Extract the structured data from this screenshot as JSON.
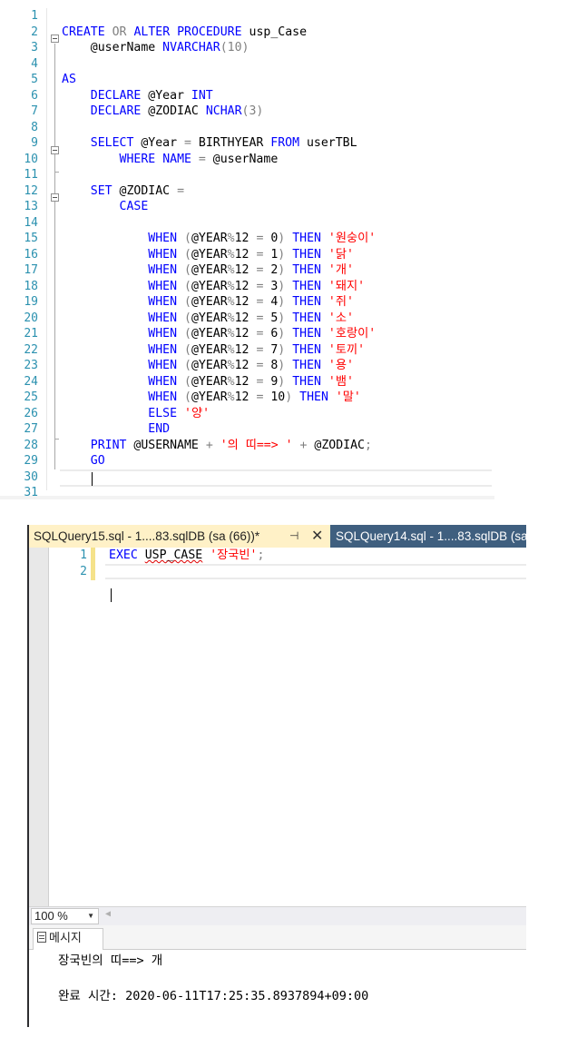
{
  "top_editor": {
    "line_numbers": [
      "1",
      "2",
      "3",
      "4",
      "5",
      "6",
      "7",
      "8",
      "9",
      "10",
      "11",
      "12",
      "13",
      "14",
      "15",
      "16",
      "17",
      "18",
      "19",
      "20",
      "21",
      "22",
      "23",
      "24",
      "25",
      "26",
      "27",
      "28",
      "29",
      "30",
      "31"
    ],
    "lines": [
      [],
      [
        {
          "t": "CREATE",
          "c": "kw"
        },
        {
          "t": " ",
          "c": ""
        },
        {
          "t": "OR",
          "c": "gray"
        },
        {
          "t": " ",
          "c": ""
        },
        {
          "t": "ALTER",
          "c": "kw"
        },
        {
          "t": " ",
          "c": ""
        },
        {
          "t": "PROCEDURE",
          "c": "kw"
        },
        {
          "t": " usp_Case",
          "c": ""
        }
      ],
      [
        {
          "t": "    @userName ",
          "c": ""
        },
        {
          "t": "NVARCHAR",
          "c": "kw"
        },
        {
          "t": "(10)",
          "c": "gray"
        }
      ],
      [],
      [
        {
          "t": "AS",
          "c": "kw"
        }
      ],
      [
        {
          "t": "    ",
          "c": ""
        },
        {
          "t": "DECLARE",
          "c": "kw"
        },
        {
          "t": " @Year ",
          "c": ""
        },
        {
          "t": "INT",
          "c": "kw"
        }
      ],
      [
        {
          "t": "    ",
          "c": ""
        },
        {
          "t": "DECLARE",
          "c": "kw"
        },
        {
          "t": " @ZODIAC ",
          "c": ""
        },
        {
          "t": "NCHAR",
          "c": "kw"
        },
        {
          "t": "(3)",
          "c": "gray"
        }
      ],
      [],
      [
        {
          "t": "    ",
          "c": ""
        },
        {
          "t": "SELECT",
          "c": "kw"
        },
        {
          "t": " @Year ",
          "c": ""
        },
        {
          "t": "=",
          "c": "gray"
        },
        {
          "t": " BIRTHYEAR ",
          "c": ""
        },
        {
          "t": "FROM",
          "c": "kw"
        },
        {
          "t": " userTBL",
          "c": ""
        }
      ],
      [
        {
          "t": "        ",
          "c": ""
        },
        {
          "t": "WHERE",
          "c": "kw"
        },
        {
          "t": " ",
          "c": ""
        },
        {
          "t": "NAME",
          "c": "kw"
        },
        {
          "t": " ",
          "c": ""
        },
        {
          "t": "=",
          "c": "gray"
        },
        {
          "t": " @userName",
          "c": ""
        }
      ],
      [],
      [
        {
          "t": "    ",
          "c": ""
        },
        {
          "t": "SET",
          "c": "kw"
        },
        {
          "t": " @ZODIAC ",
          "c": ""
        },
        {
          "t": "=",
          "c": "gray"
        }
      ],
      [
        {
          "t": "        ",
          "c": ""
        },
        {
          "t": "CASE",
          "c": "kw"
        }
      ],
      [],
      [
        {
          "t": "            ",
          "c": ""
        },
        {
          "t": "WHEN",
          "c": "kw"
        },
        {
          "t": " ",
          "c": ""
        },
        {
          "t": "(",
          "c": "gray"
        },
        {
          "t": "@YEAR",
          "c": ""
        },
        {
          "t": "%",
          "c": "gray"
        },
        {
          "t": "12 ",
          "c": ""
        },
        {
          "t": "=",
          "c": "gray"
        },
        {
          "t": " 0",
          "c": ""
        },
        {
          "t": ")",
          "c": "gray"
        },
        {
          "t": " ",
          "c": ""
        },
        {
          "t": "THEN",
          "c": "kw"
        },
        {
          "t": " ",
          "c": ""
        },
        {
          "t": "'원숭이'",
          "c": "str"
        }
      ],
      [
        {
          "t": "            ",
          "c": ""
        },
        {
          "t": "WHEN",
          "c": "kw"
        },
        {
          "t": " ",
          "c": ""
        },
        {
          "t": "(",
          "c": "gray"
        },
        {
          "t": "@YEAR",
          "c": ""
        },
        {
          "t": "%",
          "c": "gray"
        },
        {
          "t": "12 ",
          "c": ""
        },
        {
          "t": "=",
          "c": "gray"
        },
        {
          "t": " 1",
          "c": ""
        },
        {
          "t": ")",
          "c": "gray"
        },
        {
          "t": " ",
          "c": ""
        },
        {
          "t": "THEN",
          "c": "kw"
        },
        {
          "t": " ",
          "c": ""
        },
        {
          "t": "'닭'",
          "c": "str"
        }
      ],
      [
        {
          "t": "            ",
          "c": ""
        },
        {
          "t": "WHEN",
          "c": "kw"
        },
        {
          "t": " ",
          "c": ""
        },
        {
          "t": "(",
          "c": "gray"
        },
        {
          "t": "@YEAR",
          "c": ""
        },
        {
          "t": "%",
          "c": "gray"
        },
        {
          "t": "12 ",
          "c": ""
        },
        {
          "t": "=",
          "c": "gray"
        },
        {
          "t": " 2",
          "c": ""
        },
        {
          "t": ")",
          "c": "gray"
        },
        {
          "t": " ",
          "c": ""
        },
        {
          "t": "THEN",
          "c": "kw"
        },
        {
          "t": " ",
          "c": ""
        },
        {
          "t": "'개'",
          "c": "str"
        }
      ],
      [
        {
          "t": "            ",
          "c": ""
        },
        {
          "t": "WHEN",
          "c": "kw"
        },
        {
          "t": " ",
          "c": ""
        },
        {
          "t": "(",
          "c": "gray"
        },
        {
          "t": "@YEAR",
          "c": ""
        },
        {
          "t": "%",
          "c": "gray"
        },
        {
          "t": "12 ",
          "c": ""
        },
        {
          "t": "=",
          "c": "gray"
        },
        {
          "t": " 3",
          "c": ""
        },
        {
          "t": ")",
          "c": "gray"
        },
        {
          "t": " ",
          "c": ""
        },
        {
          "t": "THEN",
          "c": "kw"
        },
        {
          "t": " ",
          "c": ""
        },
        {
          "t": "'돼지'",
          "c": "str"
        }
      ],
      [
        {
          "t": "            ",
          "c": ""
        },
        {
          "t": "WHEN",
          "c": "kw"
        },
        {
          "t": " ",
          "c": ""
        },
        {
          "t": "(",
          "c": "gray"
        },
        {
          "t": "@YEAR",
          "c": ""
        },
        {
          "t": "%",
          "c": "gray"
        },
        {
          "t": "12 ",
          "c": ""
        },
        {
          "t": "=",
          "c": "gray"
        },
        {
          "t": " 4",
          "c": ""
        },
        {
          "t": ")",
          "c": "gray"
        },
        {
          "t": " ",
          "c": ""
        },
        {
          "t": "THEN",
          "c": "kw"
        },
        {
          "t": " ",
          "c": ""
        },
        {
          "t": "'쥐'",
          "c": "str"
        }
      ],
      [
        {
          "t": "            ",
          "c": ""
        },
        {
          "t": "WHEN",
          "c": "kw"
        },
        {
          "t": " ",
          "c": ""
        },
        {
          "t": "(",
          "c": "gray"
        },
        {
          "t": "@YEAR",
          "c": ""
        },
        {
          "t": "%",
          "c": "gray"
        },
        {
          "t": "12 ",
          "c": ""
        },
        {
          "t": "=",
          "c": "gray"
        },
        {
          "t": " 5",
          "c": ""
        },
        {
          "t": ")",
          "c": "gray"
        },
        {
          "t": " ",
          "c": ""
        },
        {
          "t": "THEN",
          "c": "kw"
        },
        {
          "t": " ",
          "c": ""
        },
        {
          "t": "'소'",
          "c": "str"
        }
      ],
      [
        {
          "t": "            ",
          "c": ""
        },
        {
          "t": "WHEN",
          "c": "kw"
        },
        {
          "t": " ",
          "c": ""
        },
        {
          "t": "(",
          "c": "gray"
        },
        {
          "t": "@YEAR",
          "c": ""
        },
        {
          "t": "%",
          "c": "gray"
        },
        {
          "t": "12 ",
          "c": ""
        },
        {
          "t": "=",
          "c": "gray"
        },
        {
          "t": " 6",
          "c": ""
        },
        {
          "t": ")",
          "c": "gray"
        },
        {
          "t": " ",
          "c": ""
        },
        {
          "t": "THEN",
          "c": "kw"
        },
        {
          "t": " ",
          "c": ""
        },
        {
          "t": "'호랑이'",
          "c": "str"
        }
      ],
      [
        {
          "t": "            ",
          "c": ""
        },
        {
          "t": "WHEN",
          "c": "kw"
        },
        {
          "t": " ",
          "c": ""
        },
        {
          "t": "(",
          "c": "gray"
        },
        {
          "t": "@YEAR",
          "c": ""
        },
        {
          "t": "%",
          "c": "gray"
        },
        {
          "t": "12 ",
          "c": ""
        },
        {
          "t": "=",
          "c": "gray"
        },
        {
          "t": " 7",
          "c": ""
        },
        {
          "t": ")",
          "c": "gray"
        },
        {
          "t": " ",
          "c": ""
        },
        {
          "t": "THEN",
          "c": "kw"
        },
        {
          "t": " ",
          "c": ""
        },
        {
          "t": "'토끼'",
          "c": "str"
        }
      ],
      [
        {
          "t": "            ",
          "c": ""
        },
        {
          "t": "WHEN",
          "c": "kw"
        },
        {
          "t": " ",
          "c": ""
        },
        {
          "t": "(",
          "c": "gray"
        },
        {
          "t": "@YEAR",
          "c": ""
        },
        {
          "t": "%",
          "c": "gray"
        },
        {
          "t": "12 ",
          "c": ""
        },
        {
          "t": "=",
          "c": "gray"
        },
        {
          "t": " 8",
          "c": ""
        },
        {
          "t": ")",
          "c": "gray"
        },
        {
          "t": " ",
          "c": ""
        },
        {
          "t": "THEN",
          "c": "kw"
        },
        {
          "t": " ",
          "c": ""
        },
        {
          "t": "'용'",
          "c": "str"
        }
      ],
      [
        {
          "t": "            ",
          "c": ""
        },
        {
          "t": "WHEN",
          "c": "kw"
        },
        {
          "t": " ",
          "c": ""
        },
        {
          "t": "(",
          "c": "gray"
        },
        {
          "t": "@YEAR",
          "c": ""
        },
        {
          "t": "%",
          "c": "gray"
        },
        {
          "t": "12 ",
          "c": ""
        },
        {
          "t": "=",
          "c": "gray"
        },
        {
          "t": " 9",
          "c": ""
        },
        {
          "t": ")",
          "c": "gray"
        },
        {
          "t": " ",
          "c": ""
        },
        {
          "t": "THEN",
          "c": "kw"
        },
        {
          "t": " ",
          "c": ""
        },
        {
          "t": "'뱀'",
          "c": "str"
        }
      ],
      [
        {
          "t": "            ",
          "c": ""
        },
        {
          "t": "WHEN",
          "c": "kw"
        },
        {
          "t": " ",
          "c": ""
        },
        {
          "t": "(",
          "c": "gray"
        },
        {
          "t": "@YEAR",
          "c": ""
        },
        {
          "t": "%",
          "c": "gray"
        },
        {
          "t": "12 ",
          "c": ""
        },
        {
          "t": "=",
          "c": "gray"
        },
        {
          "t": " 10",
          "c": ""
        },
        {
          "t": ")",
          "c": "gray"
        },
        {
          "t": " ",
          "c": ""
        },
        {
          "t": "THEN",
          "c": "kw"
        },
        {
          "t": " ",
          "c": ""
        },
        {
          "t": "'말'",
          "c": "str"
        }
      ],
      [
        {
          "t": "            ",
          "c": ""
        },
        {
          "t": "ELSE",
          "c": "kw"
        },
        {
          "t": " ",
          "c": ""
        },
        {
          "t": "'양'",
          "c": "str"
        }
      ],
      [
        {
          "t": "            ",
          "c": ""
        },
        {
          "t": "END",
          "c": "kw"
        }
      ],
      [
        {
          "t": "    ",
          "c": ""
        },
        {
          "t": "PRINT",
          "c": "kw"
        },
        {
          "t": " @USERNAME ",
          "c": ""
        },
        {
          "t": "+",
          "c": "gray"
        },
        {
          "t": " ",
          "c": ""
        },
        {
          "t": "'의 띠==> '",
          "c": "str"
        },
        {
          "t": " ",
          "c": ""
        },
        {
          "t": "+",
          "c": "gray"
        },
        {
          "t": " @ZODIAC",
          "c": ""
        },
        {
          "t": ";",
          "c": "gray"
        }
      ],
      [
        {
          "t": "    ",
          "c": ""
        },
        {
          "t": "GO",
          "c": "kw"
        }
      ],
      [],
      []
    ]
  },
  "tabs": {
    "active_title": "SQLQuery15.sql - 1....83.sqlDB (sa (66))*",
    "pin_icon": "⊣",
    "close_icon": "✕",
    "inactive_title": "SQLQuery14.sql - 1....83.sqlDB (sa"
  },
  "query_editor": {
    "line_numbers": [
      "1",
      "2"
    ],
    "line1": {
      "exec": "EXEC",
      "proc": "USP_CASE",
      "arg": "'장국빈'",
      "semicolon": ";"
    }
  },
  "zoom": {
    "value": "100 %"
  },
  "results": {
    "messages_tab_label": "메시지",
    "output_line": "장국빈의 띠==> 개",
    "completion_line": "완료 시간: 2020-06-11T17:25:35.8937894+09:00"
  },
  "colors": {
    "keyword": "#0000ff",
    "string": "#ff0000",
    "operator": "#808080",
    "line_number": "#2b91af",
    "active_tab_bg": "#fff1c7",
    "inactive_tab_bg": "#3f5f7f"
  }
}
